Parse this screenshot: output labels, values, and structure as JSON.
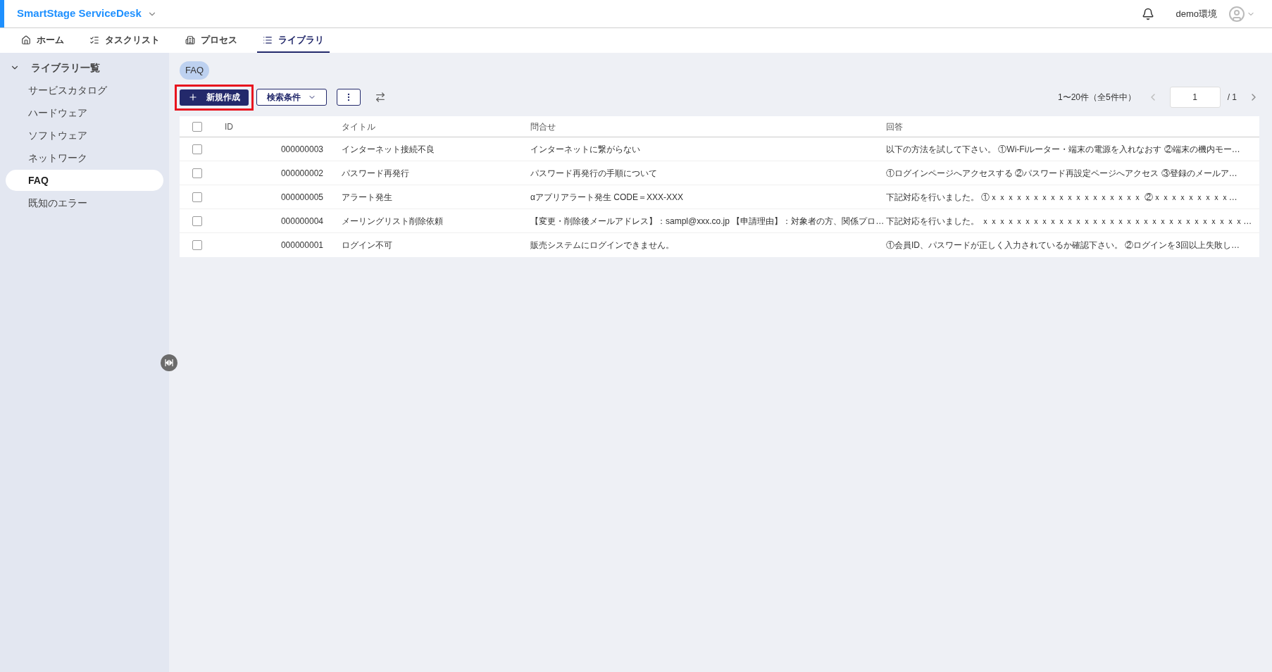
{
  "app": {
    "title": "SmartStage ServiceDesk",
    "environment": "demo環境"
  },
  "tabs": [
    {
      "label": "ホーム",
      "kind": "home",
      "selected": false
    },
    {
      "label": "タスクリスト",
      "kind": "tasks",
      "selected": false
    },
    {
      "label": "プロセス",
      "kind": "building",
      "selected": false
    },
    {
      "label": "ライブラリ",
      "kind": "list",
      "selected": true
    }
  ],
  "sidebar": {
    "heading": "ライブラリ一覧",
    "expanded": true,
    "items": [
      {
        "label": "サービスカタログ",
        "selected": false
      },
      {
        "label": "ハードウェア",
        "selected": false
      },
      {
        "label": "ソフトウェア",
        "selected": false
      },
      {
        "label": "ネットワーク",
        "selected": false
      },
      {
        "label": "FAQ",
        "selected": true
      },
      {
        "label": "既知のエラー",
        "selected": false
      }
    ]
  },
  "page": {
    "chip": "FAQ",
    "new_button": "新規作成",
    "filter_button": "検索条件",
    "range": "1〜20件（全5件中）",
    "page_input": "1",
    "page_total": "/ 1"
  },
  "table": {
    "columns": [
      "ID",
      "タイトル",
      "問合せ",
      "回答"
    ],
    "header_checked": false,
    "rows": [
      {
        "checked": false,
        "cells": [
          "000000003",
          "インターネット接続不良",
          "インターネットに繋がらない",
          "以下の方法を試して下さい。 ①Wi-Fiルーター・端末の電源を入れなおす ②端末の機内モー…"
        ]
      },
      {
        "checked": false,
        "cells": [
          "000000002",
          "パスワード再発行",
          "パスワード再発行の手順について",
          "①ログインページへアクセスする ②パスワード再設定ページへアクセス ③登録のメールア…"
        ]
      },
      {
        "checked": false,
        "cells": [
          "000000005",
          "アラート発生",
          "αアプリアラート発生 CODE＝XXX-XXX",
          "下記対応を行いました。 ①ｘｘｘｘｘｘｘｘｘｘｘｘｘｘｘｘｘｘ ②ｘｘｘｘｘｘｘｘｘ…"
        ]
      },
      {
        "checked": false,
        "cells": [
          "000000004",
          "メーリングリスト削除依頼",
          "【変更・削除後メールアドレス】：sampl@xxx.co.jp 【申請理由】：対象者の方、関係プロ…",
          "下記対応を行いました。 ｘｘｘｘｘｘｘｘｘｘｘｘｘｘｘｘｘｘｘｘｘｘｘｘｘｘｘｘｘｘｘ…"
        ]
      },
      {
        "checked": false,
        "cells": [
          "000000001",
          "ログイン不可",
          "販売システムにログインできません。",
          "①会員ID、パスワードが正しく入力されているか確認下さい。 ②ログインを3回以上失敗し…"
        ]
      }
    ]
  }
}
